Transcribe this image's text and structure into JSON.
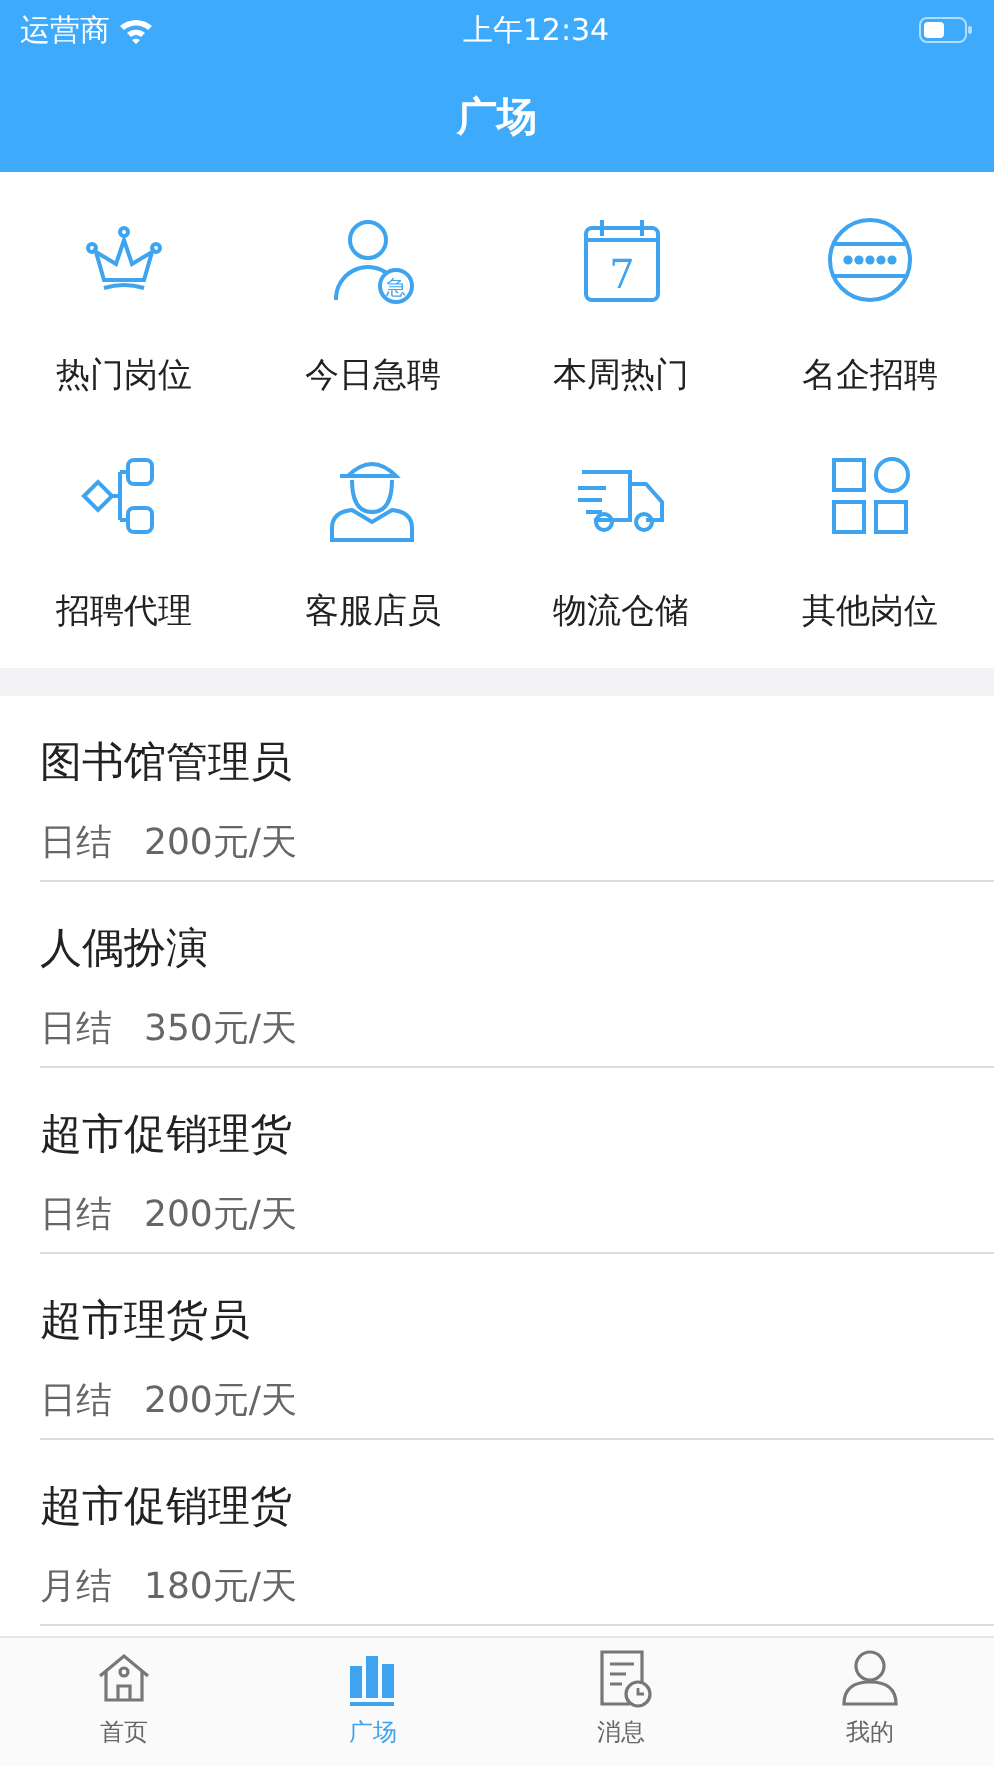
{
  "status_bar": {
    "carrier": "运营商",
    "time": "上午12:34"
  },
  "header": {
    "title": "广场"
  },
  "categories": [
    {
      "kind": "crown",
      "label": "热门岗位"
    },
    {
      "kind": "urgent",
      "label": "今日急聘",
      "icon_text": "急"
    },
    {
      "kind": "calendar",
      "label": "本周热门",
      "icon_text": "7"
    },
    {
      "kind": "company",
      "label": "名企招聘"
    },
    {
      "kind": "agent",
      "label": "招聘代理"
    },
    {
      "kind": "clerk",
      "label": "客服店员"
    },
    {
      "kind": "truck",
      "label": "物流仓储"
    },
    {
      "kind": "grid",
      "label": "其他岗位"
    }
  ],
  "jobs": [
    {
      "title": "图书馆管理员",
      "settlement": "日结",
      "pay": "200元/天"
    },
    {
      "title": "人偶扮演",
      "settlement": "日结",
      "pay": "350元/天"
    },
    {
      "title": "超市促销理货",
      "settlement": "日结",
      "pay": "200元/天"
    },
    {
      "title": "超市理货员",
      "settlement": "日结",
      "pay": "200元/天"
    },
    {
      "title": "超市促销理货",
      "settlement": "月结",
      "pay": "180元/天"
    }
  ],
  "tab_bar": [
    {
      "kind": "home",
      "label": "首页",
      "selected": false
    },
    {
      "kind": "square",
      "label": "广场",
      "selected": true
    },
    {
      "kind": "message",
      "label": "消息",
      "selected": false
    },
    {
      "kind": "profile",
      "label": "我的",
      "selected": false
    }
  ]
}
